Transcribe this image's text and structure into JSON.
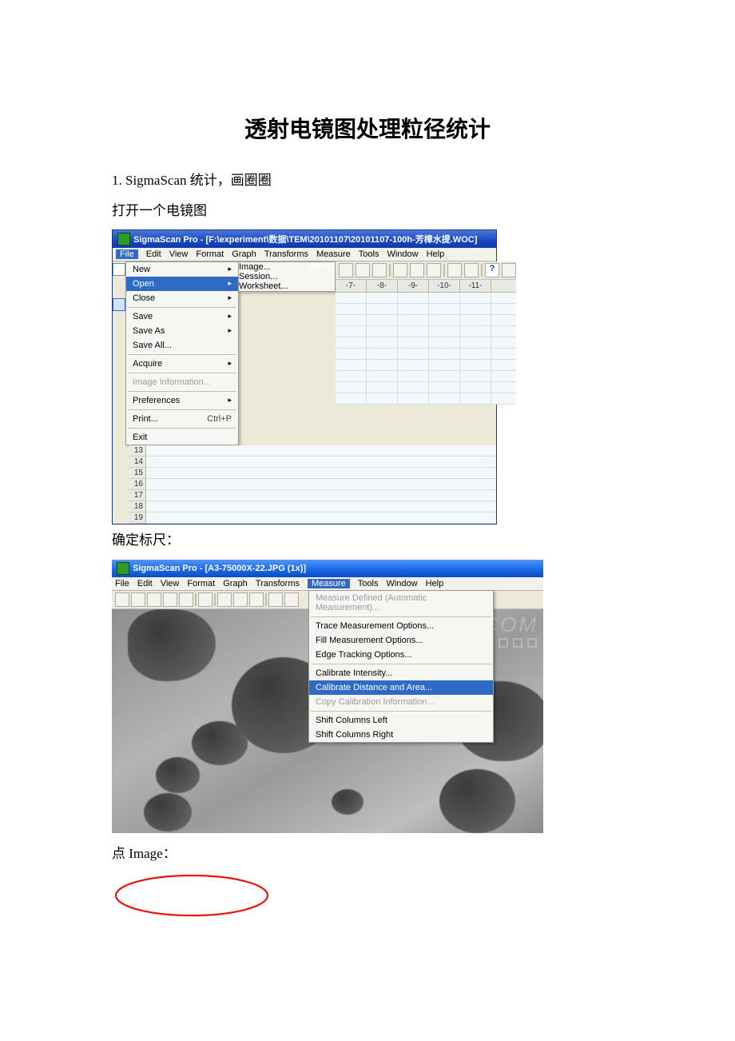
{
  "doc": {
    "title": "透射电镜图处理粒径统计",
    "step1": "1. SigmaScan 统计，画圈圈",
    "open_line": "打开一个电镜图",
    "confirm_scale": "确定标尺：",
    "click_image": "点 Image："
  },
  "ss1": {
    "title": "SigmaScan Pro - [F:\\experiment\\数据\\TEM\\20101107\\20101107-100h-芳樟水提.WOC]",
    "menus": [
      "File",
      "Edit",
      "View",
      "Format",
      "Graph",
      "Transforms",
      "Measure",
      "Tools",
      "Window",
      "Help"
    ],
    "file_menu": {
      "new": "New",
      "open": "Open",
      "close": "Close",
      "save": "Save",
      "save_as": "Save As",
      "save_all": "Save All...",
      "acquire": "Acquire",
      "image_info": "Image Information...",
      "preferences": "Preferences",
      "print": "Print...",
      "print_sc": "Ctrl+P",
      "exit": "Exit"
    },
    "open_sub": {
      "image": "Image...",
      "image_sc": "Ctrl+O",
      "session": "Session...",
      "worksheet": "Worksheet..."
    },
    "col_headers": [
      "-7-",
      "-8-",
      "-9-",
      "-10-",
      "-11-"
    ],
    "rownums": [
      "13",
      "14",
      "15",
      "16",
      "17",
      "18",
      "19"
    ]
  },
  "ss2": {
    "title": "SigmaScan Pro - [A3-75000X-22.JPG (1x)]",
    "menus": [
      "File",
      "Edit",
      "View",
      "Format",
      "Graph",
      "Transforms",
      "Measure",
      "Tools",
      "Window",
      "Help"
    ],
    "measure_menu": {
      "mdam": "Measure Defined (Automatic Measurement)...",
      "trace": "Trace Measurement Options...",
      "fill": "Fill  Measurement Options...",
      "edge": "Edge Tracking Options...",
      "calib_i": "Calibrate Intensity...",
      "calib_d": "Calibrate Distance and Area...",
      "copy": "Copy Calibration Information...",
      "shl": "Shift Columns Left",
      "shr": "Shift Columns Right"
    },
    "watermark": "X.COM"
  }
}
